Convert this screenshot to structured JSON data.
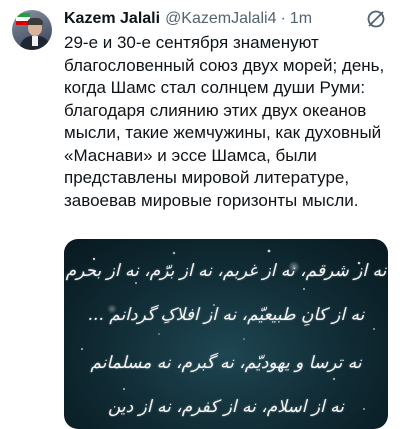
{
  "tweet": {
    "author_name": "Kazem Jalali",
    "author_handle": "@KazemJalali4",
    "separator": "·",
    "timestamp": "1m",
    "text": "29-е и 30-е сентября знаменуют благословенный союз двух морей; день, когда Шамс стал солнцем души Руми: благодаря слиянию этих двух океанов мысли, такие жемчужины, как духовный «Маснави» и эссе Шамса, были представлены мировой литературе, завоевав мировые горизонты мысли.",
    "media": {
      "lines": [
        "نه از شرقم، نه از غربم، نه از برّم، نه از بحرم",
        "نه از کانِ طبیعیّم، نه از افلاکِ گردانم ...",
        "نه ترسا و یهودیّم، نه گبرم، نه مسلمانم",
        "نه از اسلام، نه از کفرم، نه از دین"
      ]
    }
  },
  "icons": {
    "more": "more-horizontal-icon"
  },
  "colors": {
    "text_primary": "#0f1419",
    "text_secondary": "#536471",
    "image_background": "#102a33"
  }
}
